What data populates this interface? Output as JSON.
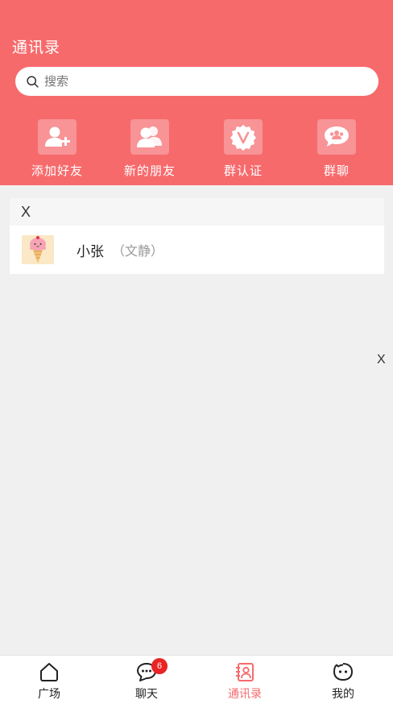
{
  "header": {
    "title": "通讯录",
    "search_placeholder": "搜索"
  },
  "quick_actions": [
    {
      "label": "添加好友",
      "icon": "add-friend-icon"
    },
    {
      "label": "新的朋友",
      "icon": "new-friends-icon"
    },
    {
      "label": "群认证",
      "icon": "group-verify-icon"
    },
    {
      "label": "群聊",
      "icon": "group-chat-icon"
    }
  ],
  "contact_group": {
    "header_letter": "X",
    "contacts": [
      {
        "name": "小张",
        "note": "（文静）",
        "avatar": "ice-cream-avatar"
      }
    ]
  },
  "side_index_letter": "X",
  "tabbar": {
    "tabs": [
      {
        "label": "广场",
        "icon": "home-icon",
        "active": false
      },
      {
        "label": "聊天",
        "icon": "chat-icon",
        "active": false,
        "badge": "6"
      },
      {
        "label": "通讯录",
        "icon": "contacts-icon",
        "active": true
      },
      {
        "label": "我的",
        "icon": "profile-icon",
        "active": false
      }
    ]
  },
  "colors": {
    "brand": "#f76a6c",
    "icon_tile": "#f89396",
    "badge": "#e92424",
    "background": "#f0f0f0"
  }
}
